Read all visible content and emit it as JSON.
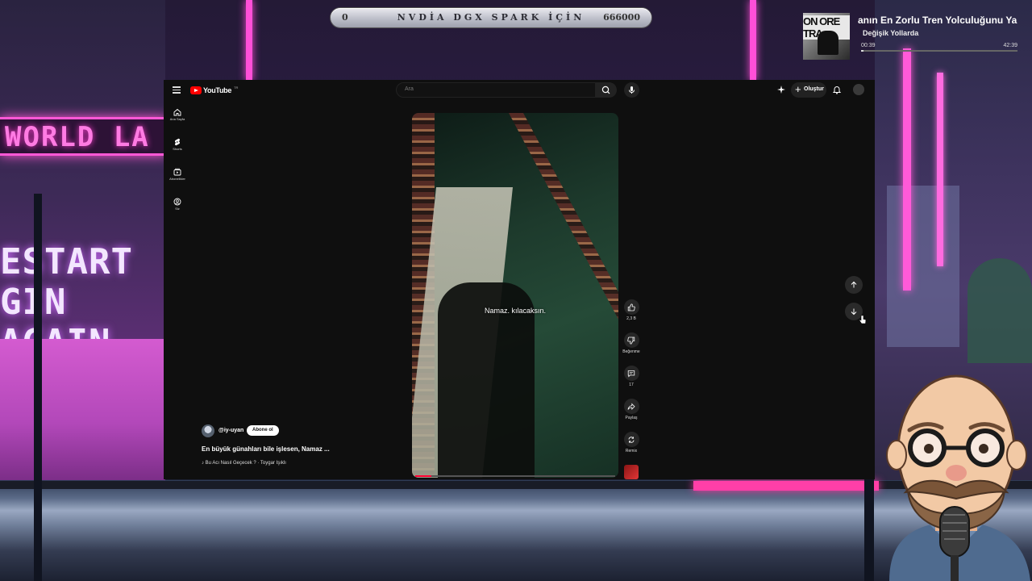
{
  "stream": {
    "banner": {
      "left_value": "0",
      "title": "NVDİA DGX SPARK İÇİN",
      "right_value": "666000"
    },
    "background_signs": {
      "top_sign": "WORLD LA",
      "middle_sign_line1": "ESTART",
      "middle_sign_line2": "GIN AGAIN"
    },
    "now_playing": {
      "art_text": "ON ORE TRA",
      "title": "anın En Zorlu Tren Yolculuğunu Ya",
      "artist": "Değişik Yollarda",
      "current_time": "00:39",
      "total_time": "42:39",
      "progress": 0.015
    }
  },
  "youtube": {
    "logo": {
      "text": "YouTube",
      "region": "TR"
    },
    "search": {
      "placeholder": "Ara"
    },
    "header": {
      "create_label": "Oluştur"
    },
    "sidebar": {
      "items": [
        {
          "label": "Ana Sayfa",
          "icon": "home-icon"
        },
        {
          "label": "Shorts",
          "icon": "shorts-icon"
        },
        {
          "label": "Abonelikler",
          "icon": "subscriptions-icon"
        },
        {
          "label": "Siz",
          "icon": "you-icon"
        }
      ]
    },
    "short": {
      "caption": "Namaz. kılacaksın.",
      "progress": 0.08,
      "channel": "@iy-uyan",
      "subscribe_label": "Abone ol",
      "title": "En büyük günahları bile işlesen, Namaz ...",
      "music": "♪ Bu Acı Nasıl Geçecek ? · Toygar Işıklı"
    },
    "actions": {
      "like_count": "2,3 B",
      "dislike_label": "Beğenme",
      "comment_count": "17",
      "share_label": "Paylaş",
      "remix_label": "Remix"
    },
    "colors": {
      "background": "#0f0f0f",
      "brand_red": "#ff0000",
      "progress": "#ff0033"
    }
  }
}
